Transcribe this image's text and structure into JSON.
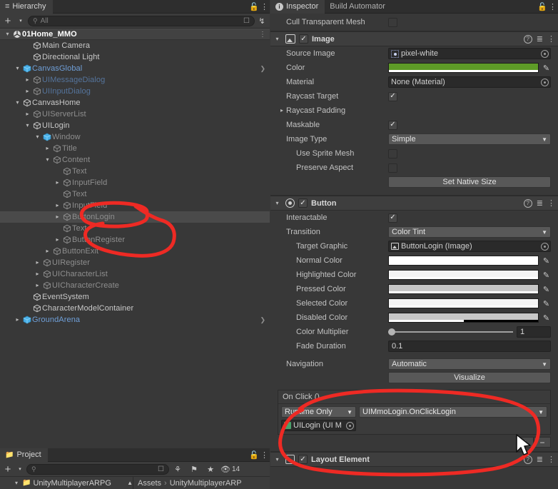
{
  "hierarchy": {
    "tab_label": "Hierarchy",
    "tab_icon": "hierarchy-icon",
    "lock_icon": "lock-icon",
    "menu_icon": "kebab-menu-icon",
    "toolbar": {
      "add_label": "+",
      "add_dropdown": "▾",
      "search_placeholder": "All",
      "search_value": "",
      "search_icon": "search-icon",
      "visibility_icon": "visibility-toggle-icon",
      "sort_icon": "alphabetical-sort-icon"
    },
    "items": [
      {
        "label": "01Home_MMO",
        "depth": 0,
        "expander": "open",
        "icon": "scene-icon",
        "style": "scene",
        "selected": false,
        "rowmenu": true
      },
      {
        "label": "Main Camera",
        "depth": 2,
        "expander": "none",
        "icon": "gameobject-icon",
        "style": "normal",
        "selected": false
      },
      {
        "label": "Directional Light",
        "depth": 2,
        "expander": "none",
        "icon": "gameobject-icon",
        "style": "normal",
        "selected": false
      },
      {
        "label": "CanvasGlobal",
        "depth": 1,
        "expander": "open",
        "icon": "prefab-icon",
        "style": "prefab",
        "selected": false,
        "rowchev": true
      },
      {
        "label": "UIMessageDialog",
        "depth": 2,
        "expander": "closed",
        "icon": "gameobject-icon",
        "style": "prefabdim",
        "selected": false
      },
      {
        "label": "UIInputDialog",
        "depth": 2,
        "expander": "closed",
        "icon": "gameobject-icon",
        "style": "prefabdim",
        "selected": false
      },
      {
        "label": "CanvasHome",
        "depth": 1,
        "expander": "open",
        "icon": "gameobject-icon",
        "style": "normal",
        "selected": false
      },
      {
        "label": "UIServerList",
        "depth": 2,
        "expander": "closed",
        "icon": "gameobject-icon",
        "style": "dim",
        "selected": false
      },
      {
        "label": "UILogin",
        "depth": 2,
        "expander": "open",
        "icon": "gameobject-icon",
        "style": "normal",
        "selected": false
      },
      {
        "label": "Window",
        "depth": 3,
        "expander": "open",
        "icon": "prefab-icon",
        "style": "dim",
        "selected": false
      },
      {
        "label": "Title",
        "depth": 4,
        "expander": "closed",
        "icon": "gameobject-icon",
        "style": "dim",
        "selected": false
      },
      {
        "label": "Content",
        "depth": 4,
        "expander": "open",
        "icon": "gameobject-icon",
        "style": "dim",
        "selected": false
      },
      {
        "label": "Text",
        "depth": 5,
        "expander": "none",
        "icon": "gameobject-icon",
        "style": "dim",
        "selected": false
      },
      {
        "label": "InputField",
        "depth": 5,
        "expander": "closed",
        "icon": "gameobject-icon",
        "style": "dim",
        "selected": false
      },
      {
        "label": "Text",
        "depth": 5,
        "expander": "none",
        "icon": "gameobject-icon",
        "style": "dim",
        "selected": false
      },
      {
        "label": "InputField",
        "depth": 5,
        "expander": "closed",
        "icon": "gameobject-icon",
        "style": "dim",
        "selected": false
      },
      {
        "label": "ButtonLogin",
        "depth": 5,
        "expander": "closed",
        "icon": "gameobject-icon",
        "style": "dim",
        "selected": true
      },
      {
        "label": "Text",
        "depth": 5,
        "expander": "none",
        "icon": "gameobject-icon",
        "style": "dim",
        "selected": false
      },
      {
        "label": "ButtonRegister",
        "depth": 5,
        "expander": "closed",
        "icon": "gameobject-icon",
        "style": "dim",
        "selected": false
      },
      {
        "label": "ButtonExit",
        "depth": 4,
        "expander": "closed",
        "icon": "gameobject-icon",
        "style": "dim",
        "selected": false
      },
      {
        "label": "UIRegister",
        "depth": 3,
        "expander": "closed",
        "icon": "gameobject-icon",
        "style": "dim",
        "selected": false
      },
      {
        "label": "UICharacterList",
        "depth": 3,
        "expander": "closed",
        "icon": "gameobject-icon",
        "style": "dim",
        "selected": false
      },
      {
        "label": "UICharacterCreate",
        "depth": 3,
        "expander": "closed",
        "icon": "gameobject-icon",
        "style": "dim",
        "selected": false
      },
      {
        "label": "EventSystem",
        "depth": 2,
        "expander": "none",
        "icon": "gameobject-icon",
        "style": "normal",
        "selected": false
      },
      {
        "label": "CharacterModelContainer",
        "depth": 2,
        "expander": "none",
        "icon": "gameobject-icon",
        "style": "normal",
        "selected": false
      },
      {
        "label": "GroundArena",
        "depth": 1,
        "expander": "closed",
        "icon": "prefab-icon",
        "style": "prefab",
        "selected": false,
        "rowchev": true
      }
    ]
  },
  "project": {
    "tab_label": "Project",
    "tab_icon": "folder-icon",
    "lock_icon": "lock-icon",
    "menu_icon": "kebab-menu-icon",
    "toolbar": {
      "add_label": "+",
      "add_dropdown": "▾",
      "search_placeholder": "",
      "search_value": "",
      "search_icon": "search-icon",
      "save_search_icon": "save-search-icon",
      "filter_type_icon": "filter-by-type-icon",
      "filter_label_icon": "filter-by-label-icon",
      "favorite_icon": "star-icon",
      "hidden_count_icon": "hidden-packages-icon",
      "hidden_count": "14"
    },
    "breadcrumb_tree_item": "UnityMultiplayerARPG",
    "breadcrumb": [
      "Assets",
      "UnityMultiplayerARP"
    ],
    "breadcrumb_separator": "›",
    "sort_icon": "sort-ascending-icon"
  },
  "inspector": {
    "tabs": [
      {
        "label": "Inspector",
        "icon": "info-icon",
        "active": true
      },
      {
        "label": "Build Automator",
        "icon": "",
        "active": false
      }
    ],
    "lock_icon": "lock-icon",
    "menu_icon": "kebab-menu-icon",
    "orphan_row": {
      "label": "Cull Transparent Mesh",
      "checked": false
    },
    "image_component": {
      "title": "Image",
      "icon": "image-component-icon",
      "enabled": true,
      "help_icon": "help-icon",
      "preset_icon": "preset-icon",
      "menu_icon": "kebab-menu-icon",
      "fields": {
        "source_image_label": "Source Image",
        "source_image_value": "pixel-white",
        "source_image_icon": "sprite-icon",
        "color_label": "Color",
        "color_value": "#5E9B27",
        "color_alpha_pct": 100,
        "material_label": "Material",
        "material_value": "None (Material)",
        "raycast_target_label": "Raycast Target",
        "raycast_target_checked": true,
        "raycast_padding_label": "Raycast Padding",
        "maskable_label": "Maskable",
        "maskable_checked": true,
        "image_type_label": "Image Type",
        "image_type_value": "Simple",
        "use_sprite_mesh_label": "Use Sprite Mesh",
        "use_sprite_mesh_checked": false,
        "preserve_aspect_label": "Preserve Aspect",
        "preserve_aspect_checked": false,
        "set_native_size_label": "Set Native Size"
      }
    },
    "button_component": {
      "title": "Button",
      "icon": "button-component-icon",
      "enabled": true,
      "help_icon": "help-icon",
      "preset_icon": "preset-icon",
      "menu_icon": "kebab-menu-icon",
      "fields": {
        "interactable_label": "Interactable",
        "interactable_checked": true,
        "transition_label": "Transition",
        "transition_value": "Color Tint",
        "target_graphic_label": "Target Graphic",
        "target_graphic_value": "ButtonLogin (Image)",
        "target_graphic_icon": "image-component-icon",
        "normal_color_label": "Normal Color",
        "normal_color_value": "#FFFFFF",
        "normal_color_alpha_pct": 100,
        "highlighted_color_label": "Highlighted Color",
        "highlighted_color_value": "#F5F5F5",
        "highlighted_color_alpha_pct": 100,
        "pressed_color_label": "Pressed Color",
        "pressed_color_value": "#C8C8C8",
        "pressed_color_alpha_pct": 100,
        "selected_color_label": "Selected Color",
        "selected_color_value": "#F5F5F5",
        "selected_color_alpha_pct": 100,
        "disabled_color_label": "Disabled Color",
        "disabled_color_value": "#C8C8C8",
        "disabled_color_alpha_pct": 50,
        "color_multiplier_label": "Color Multiplier",
        "color_multiplier_value": "1",
        "color_multiplier_pct": 0,
        "fade_duration_label": "Fade Duration",
        "fade_duration_value": "0.1",
        "navigation_label": "Navigation",
        "navigation_value": "Automatic",
        "visualize_label": "Visualize"
      },
      "on_click": {
        "title": "On Click ()",
        "entries": [
          {
            "mode": "Runtime Only",
            "function": "UIMmoLogin.OnClickLogin",
            "object": "UILogin (UI M",
            "object_icon": "script-icon"
          }
        ],
        "add_label": "+",
        "remove_label": "−"
      }
    },
    "layout_element_component": {
      "title": "Layout Element",
      "icon": "layout-element-icon",
      "enabled": true
    }
  },
  "annotations": {
    "cursor_icon": "mouse-cursor",
    "highlight_color": "#EE2A24",
    "marks": [
      {
        "name": "hierarchy-buttonlogin-circle"
      },
      {
        "name": "hierarchy-buttonregister-circle"
      },
      {
        "name": "onclick-section-circle"
      }
    ]
  }
}
